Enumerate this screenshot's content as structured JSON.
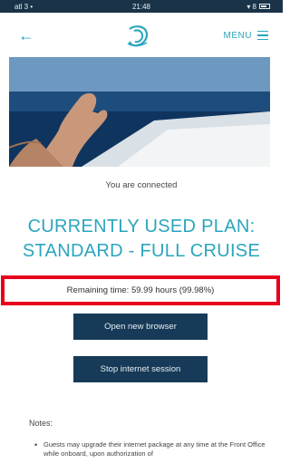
{
  "status_bar": {
    "carrier": "atl 3 •",
    "time": "21:48",
    "right": "▾ 8"
  },
  "nav": {
    "menu_label": "MENU",
    "icons": [
      "back-arrow-icon",
      "ship-logo-icon",
      "hamburger-icon"
    ]
  },
  "main": {
    "connected_text": "You are connected",
    "plan_title_line1": "CURRENTLY USED PLAN:",
    "plan_title_line2": "STANDARD - FULL CRUISE",
    "remaining_text": "Remaining time: 59.99 hours (99.98%)",
    "open_browser_label": "Open new browser",
    "stop_session_label": "Stop internet session"
  },
  "notes": {
    "label": "Notes:",
    "items": [
      "Guests may upgrade their internet package at any time at the Front Office while onboard, upon authorization of"
    ]
  },
  "colors": {
    "accent": "#2ba5bd",
    "button": "#163a58",
    "highlight": "#e6001c"
  }
}
